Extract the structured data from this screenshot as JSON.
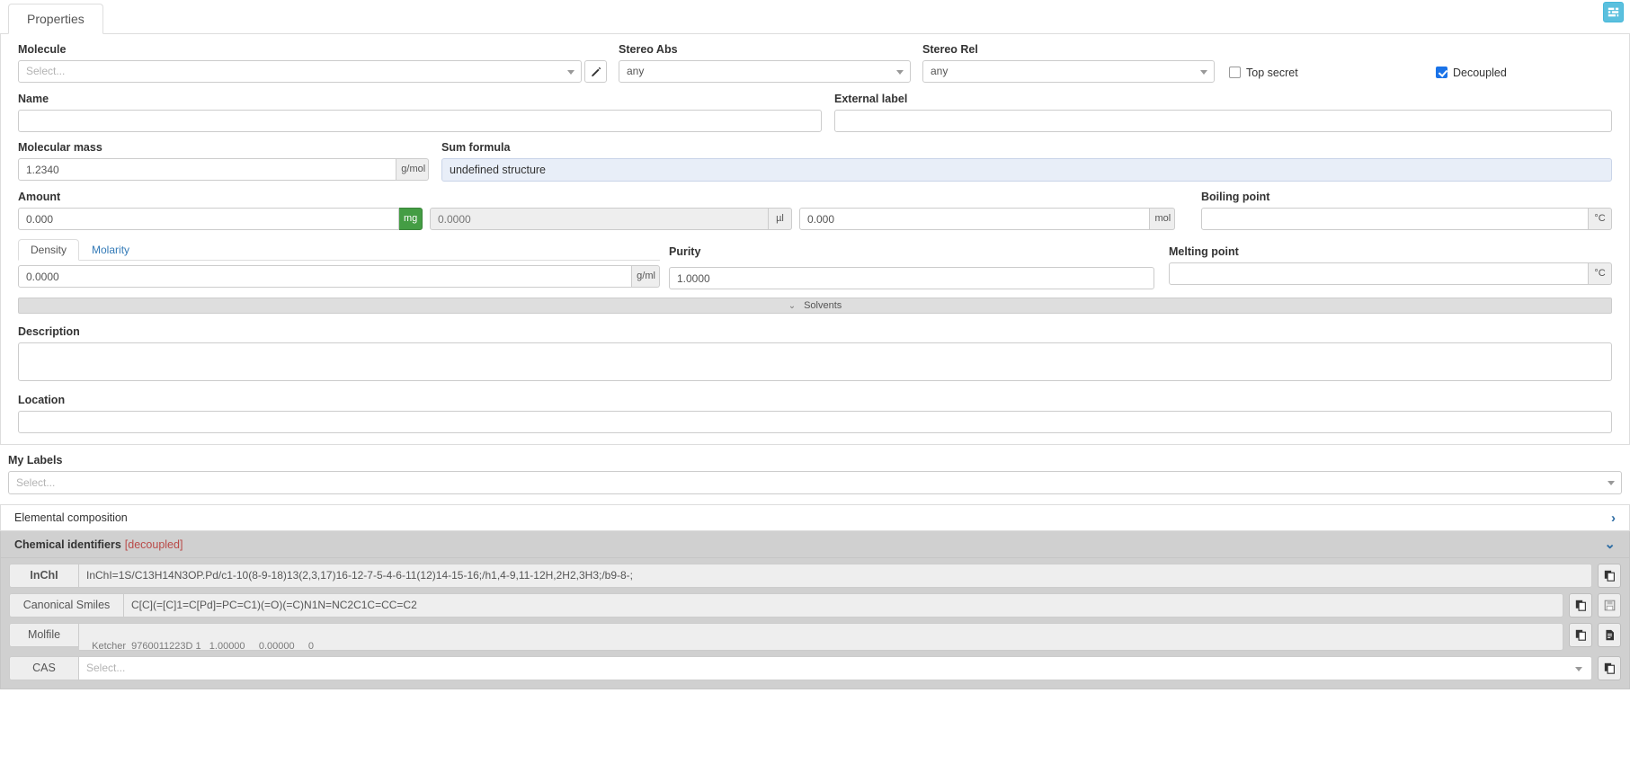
{
  "tab": {
    "label": "Properties"
  },
  "top_right": {
    "icon": "list-settings-icon"
  },
  "molecule": {
    "label": "Molecule",
    "placeholder": "Select...",
    "edit_icon": "pencil-icon"
  },
  "stereo_abs": {
    "label": "Stereo Abs",
    "value": "any"
  },
  "stereo_rel": {
    "label": "Stereo Rel",
    "value": "any"
  },
  "top_secret": {
    "label": "Top secret",
    "checked": false
  },
  "decoupled": {
    "label": "Decoupled",
    "checked": true
  },
  "name": {
    "label": "Name",
    "value": ""
  },
  "external_label": {
    "label": "External label",
    "value": ""
  },
  "molecular_mass": {
    "label": "Molecular mass",
    "value": "1.2340",
    "unit": "g/mol"
  },
  "sum_formula": {
    "label": "Sum formula",
    "value": "undefined structure"
  },
  "amount": {
    "label": "Amount",
    "mass_value": "0.000",
    "mass_unit": "mg",
    "volume_value": "0.0000",
    "volume_unit": "µl",
    "mol_value": "0.000",
    "mol_unit": "mol"
  },
  "boiling_point": {
    "label": "Boiling point",
    "value": "",
    "unit": "°C"
  },
  "density_tabs": {
    "density": "Density",
    "molarity": "Molarity",
    "active": "Density"
  },
  "density": {
    "value": "0.0000",
    "unit": "g/ml"
  },
  "purity": {
    "label": "Purity",
    "value": "1.0000"
  },
  "melting_point": {
    "label": "Melting point",
    "value": "",
    "unit": "°C"
  },
  "solvents": {
    "label": "Solvents",
    "chevron": "chevron-double-down-icon"
  },
  "description": {
    "label": "Description",
    "value": ""
  },
  "location": {
    "label": "Location",
    "value": ""
  },
  "my_labels": {
    "label": "My Labels",
    "placeholder": "Select..."
  },
  "elemental_composition": {
    "label": "Elemental composition",
    "chevron": "chevron-right-icon"
  },
  "chemical_identifiers": {
    "label": "Chemical identifiers",
    "badge": "[decoupled]",
    "chevron": "chevron-down-icon"
  },
  "identifiers": {
    "inchi": {
      "label": "InChI",
      "value": "InChI=1S/C13H14N3OP.Pd/c1-10(8-9-18)13(2,3,17)16-12-7-5-4-6-11(12)14-15-16;/h1,4-9,11-12H,2H2,3H3;/b9-8-;",
      "copy_icon": "copy-icon"
    },
    "smiles": {
      "label": "Canonical Smiles",
      "value": "C[C](=[C]1=C[Pd]=PC=C1)(=O)(=C)N1N=NC2C1C=CC=C2",
      "copy_icon": "copy-icon",
      "save_icon": "save-icon"
    },
    "molfile": {
      "label": "Molfile",
      "value": "  Ketcher  9760011223D 1   1.00000     0.00000     0",
      "copy_icon": "copy-icon",
      "file_icon": "file-icon"
    },
    "cas": {
      "label": "CAS",
      "placeholder": "Select...",
      "copy_icon": "copy-icon"
    }
  }
}
